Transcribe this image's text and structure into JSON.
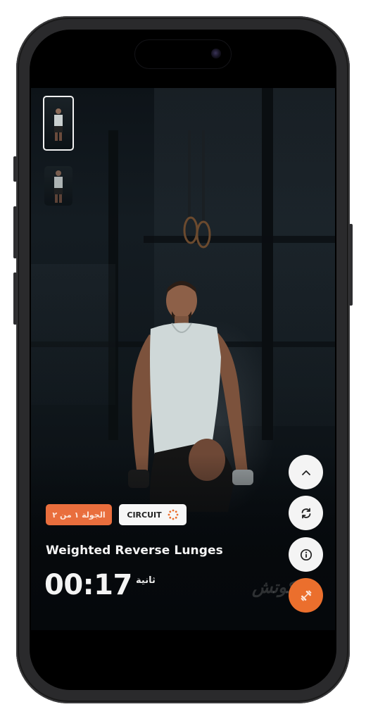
{
  "device": {
    "frame_color": "#2a2a2c"
  },
  "playlist": {
    "thumbnails": [
      {
        "label": "exercise-1",
        "active": true
      },
      {
        "label": "exercise-2",
        "active": false
      }
    ]
  },
  "workout": {
    "round_badge": "الجولة ١ من ٢",
    "type_badge": "CIRCUIT",
    "exercise_title": "Weighted Reverse Lunges",
    "timer": "00:17",
    "timer_unit": "ثانية",
    "watermark": "كوتش"
  },
  "actions": [
    {
      "name": "expand-up",
      "icon": "chevron-up-icon"
    },
    {
      "name": "swap-exercise",
      "icon": "refresh-icon"
    },
    {
      "name": "exercise-info",
      "icon": "info-icon"
    },
    {
      "name": "equipment",
      "icon": "dumbbell-icon"
    }
  ],
  "colors": {
    "accent": "#eb6f2d",
    "badge_orange": "#e96e3d",
    "fab_light": "#f4f4f4",
    "text_light": "#f4f4f4"
  }
}
